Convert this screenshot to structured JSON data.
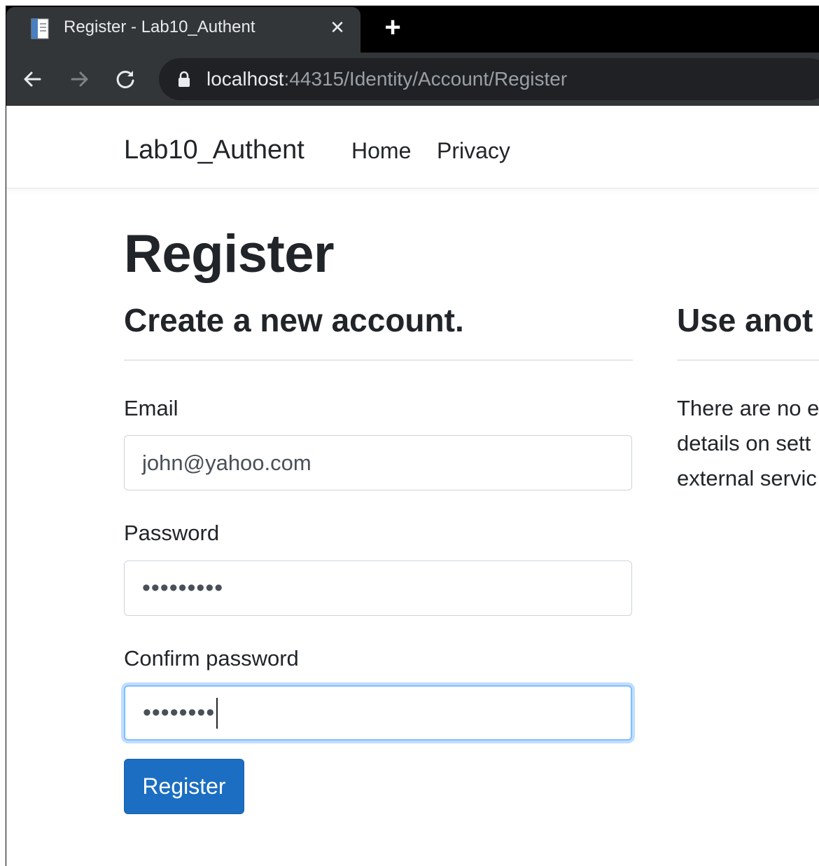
{
  "browser": {
    "tab_title": "Register - Lab10_Authent",
    "url_host": "localhost",
    "url_rest": ":44315/Identity/Account/Register"
  },
  "navbar": {
    "brand": "Lab10_Authent",
    "links": [
      "Home",
      "Privacy"
    ]
  },
  "main": {
    "title": "Register",
    "subtitle": "Create a new account.",
    "email": {
      "label": "Email",
      "value": "john@yahoo.com"
    },
    "password": {
      "label": "Password",
      "masked": "•••••••••"
    },
    "confirm_password": {
      "label": "Confirm password",
      "masked": "••••••••"
    },
    "submit_label": "Register"
  },
  "external": {
    "title": "Use anot",
    "lines": [
      "There are no e",
      "details on sett",
      "external servic"
    ]
  }
}
